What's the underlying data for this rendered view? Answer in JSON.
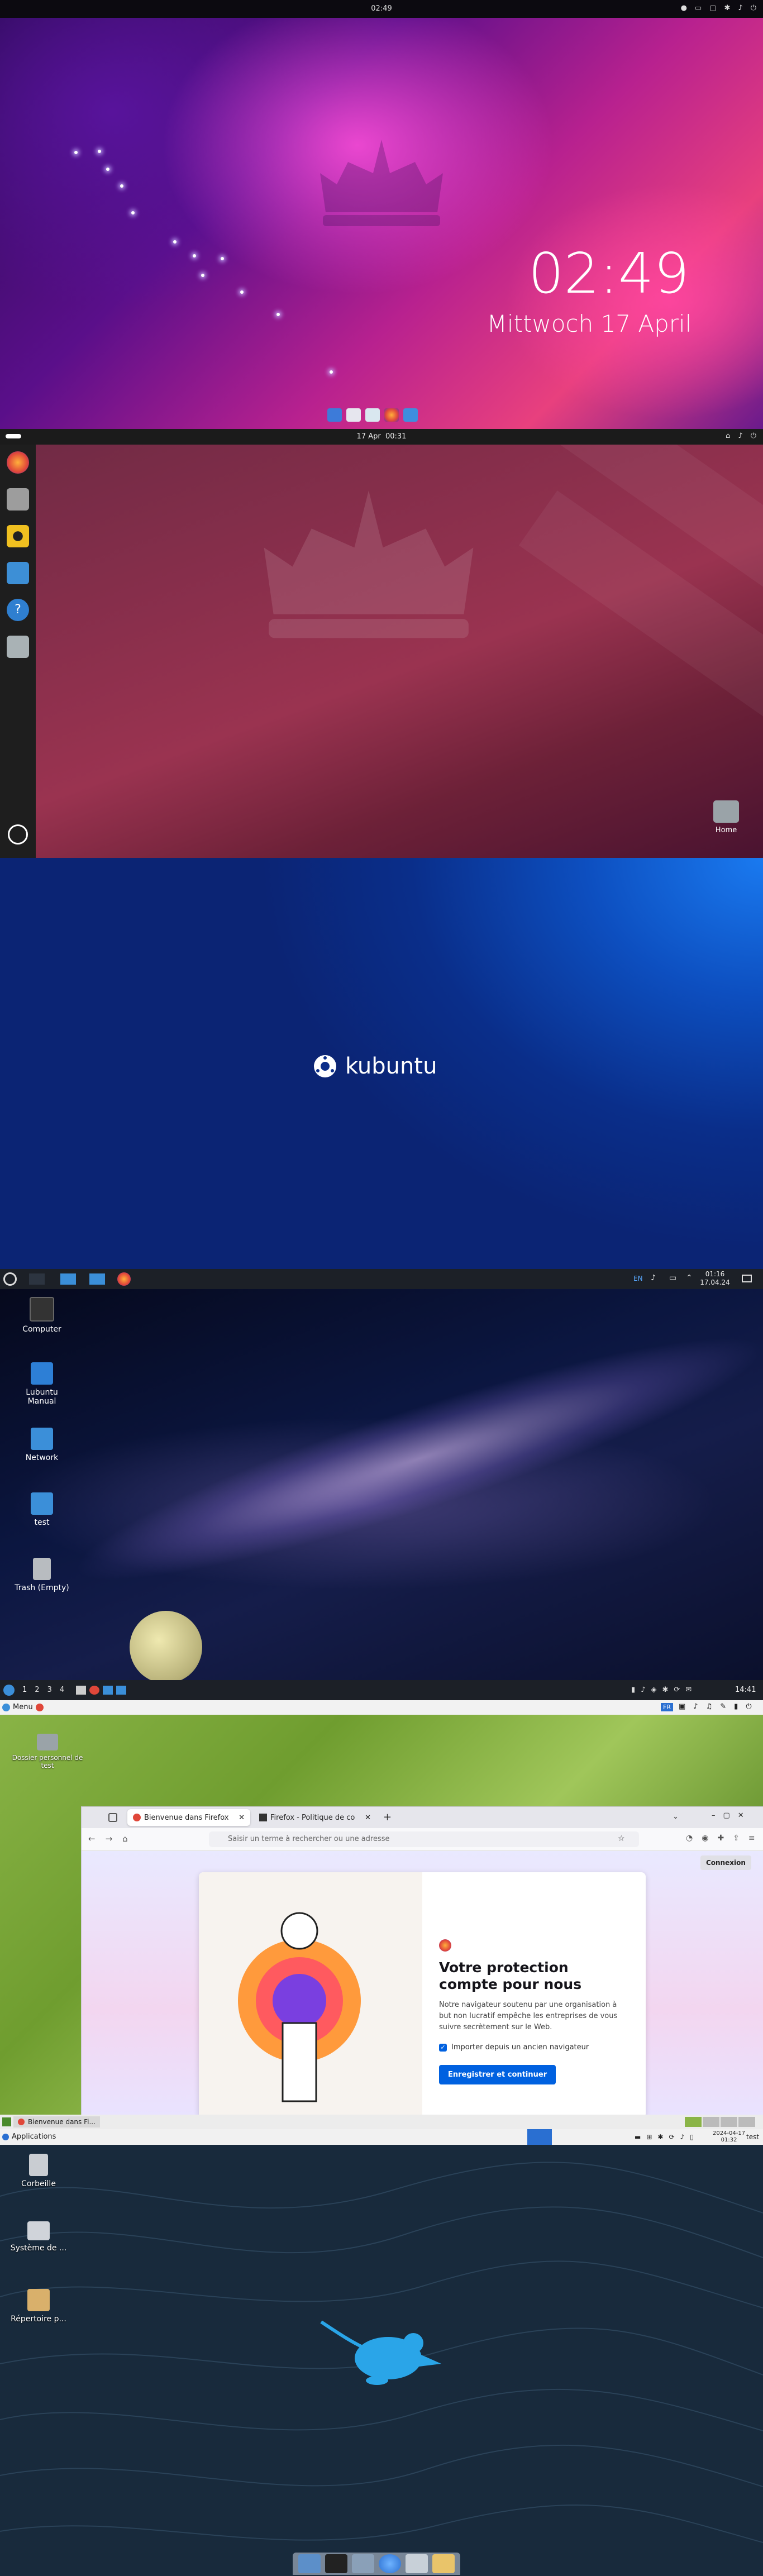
{
  "budgie": {
    "panel_clock": "02:49",
    "lock_time": "02:49",
    "lock_date": "Mittwoch 17 April",
    "colors": {
      "panel": "#0c0a10",
      "accent": "#e8407e"
    }
  },
  "unity": {
    "panel_date": "17 Apr",
    "panel_time": "00:31",
    "home_label": "Home",
    "launcher_icons": [
      "firefox-icon",
      "files-icon",
      "rhythmbox-icon",
      "software-icon",
      "help-icon",
      "trash-icon",
      "ubuntu-logo-icon"
    ]
  },
  "kubuntu": {
    "brand": "kubuntu"
  },
  "lubuntu": {
    "tray_lang": "EN",
    "clock_time": "01:16",
    "clock_date": "17.04.24",
    "desktop_icons": [
      "Computer",
      "Lubuntu Manual",
      "Network",
      "test",
      "Trash (Empty)"
    ],
    "workspaces": [
      "1",
      "2",
      "3",
      "4"
    ],
    "bottom_clock": "14:41"
  },
  "xubuntu_ff": {
    "menu_label": "Menu",
    "lang_badge": "FR",
    "desktop_icon_label": "Dossier personnel de test",
    "tabs": [
      {
        "label": "Bienvenue dans Firefox",
        "active": true
      },
      {
        "label": "Firefox - Politique de co",
        "active": false
      }
    ],
    "url_placeholder": "Saisir un terme à rechercher ou une adresse",
    "connexion": "Connexion",
    "card_title": "Votre protection compte pour nous",
    "card_body": "Notre navigateur soutenu par une organisation à but non lucratif empêche les entreprises de vous suivre secrètement sur le Web.",
    "import_label": "Importer depuis un ancien navigateur",
    "save_button": "Enregistrer et continuer",
    "taskbar_item": "Bienvenue dans Fi..."
  },
  "xubuntu": {
    "applications": "Applications",
    "clock_date": "2024-04-17",
    "clock_time": "01:32",
    "user": "test",
    "desktop_icons": [
      "Corbeille",
      "Système de ...",
      "Répertoire p..."
    ]
  }
}
